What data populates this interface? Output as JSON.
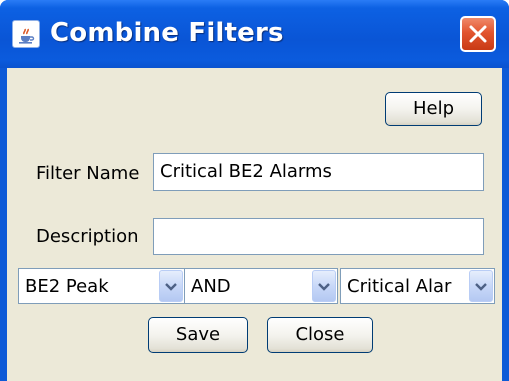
{
  "window": {
    "title": "Combine Filters"
  },
  "buttons": {
    "help": "Help",
    "save": "Save",
    "close": "Close"
  },
  "form": {
    "filter_name_label": "Filter Name",
    "filter_name_value": "Critical BE2 Alarms",
    "description_label": "Description",
    "description_value": ""
  },
  "combos": {
    "left_filter": "BE2 Peak",
    "operator": "AND",
    "right_filter": "Critical Alar"
  },
  "icons": {
    "title": "java-cup-icon",
    "close": "close-x-icon",
    "dropdown": "chevron-down-icon"
  },
  "colors": {
    "titlebar": "#0a55d6",
    "close_button": "#e2552f",
    "client_background": "#ece9d8",
    "field_border": "#7f9db9",
    "button_border": "#003c74"
  }
}
